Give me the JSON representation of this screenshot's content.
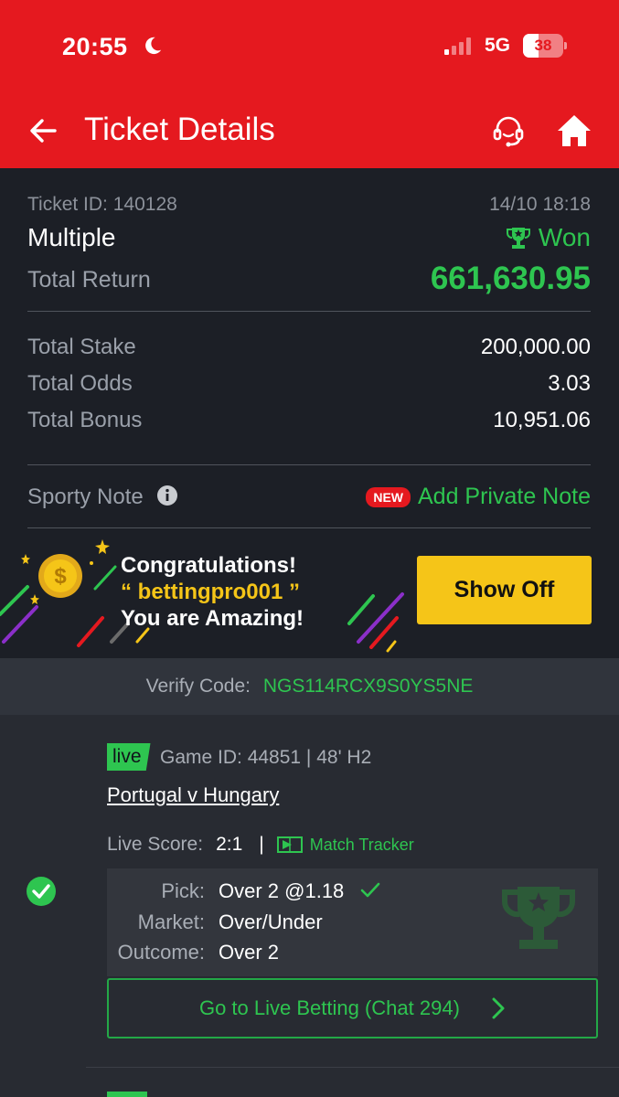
{
  "status_bar": {
    "time": "20:55",
    "network": "5G",
    "battery": "38",
    "battery_level": 0.38,
    "signal_bars": 1
  },
  "header": {
    "title": "Ticket Details",
    "back_icon": "arrow-left-icon",
    "support_icon": "headset-icon",
    "home_icon": "home-icon",
    "background_color": "#e5191f"
  },
  "ticket": {
    "id_label": "Ticket ID: 140128",
    "datetime": "14/10 18:18",
    "type": "Multiple",
    "status": "Won",
    "total_return_label": "Total Return",
    "total_return": "661,630.95",
    "total_stake_label": "Total Stake",
    "total_stake": "200,000.00",
    "total_odds_label": "Total Odds",
    "total_odds": "3.03",
    "total_bonus_label": "Total Bonus",
    "total_bonus": "10,951.06",
    "note_label": "Sporty Note",
    "new_badge": "NEW",
    "add_note": "Add Private Note",
    "accent_color": "#2ec550"
  },
  "banner": {
    "line1": "Congratulations!",
    "line2": "“ bettingpro001 ”",
    "line3": "You are Amazing!",
    "button": "Show Off"
  },
  "verify": {
    "label": "Verify Code:",
    "code": "NGS114RCX9S0YS5NE"
  },
  "game": {
    "live_tag": "live",
    "game_id": "Game ID: 44851 | 48' H2",
    "match": "Portugal v Hungary",
    "live_score_label": "Live Score:",
    "live_score": "2:1",
    "separator": "|",
    "tracker": "Match Tracker",
    "pick_label": "Pick:",
    "pick_value": "Over 2 @1.18",
    "market_label": "Market:",
    "market_value": "Over/Under",
    "outcome_label": "Outcome:",
    "outcome_value": "Over 2",
    "live_betting_button": "Go to Live Betting (Chat 294)"
  }
}
